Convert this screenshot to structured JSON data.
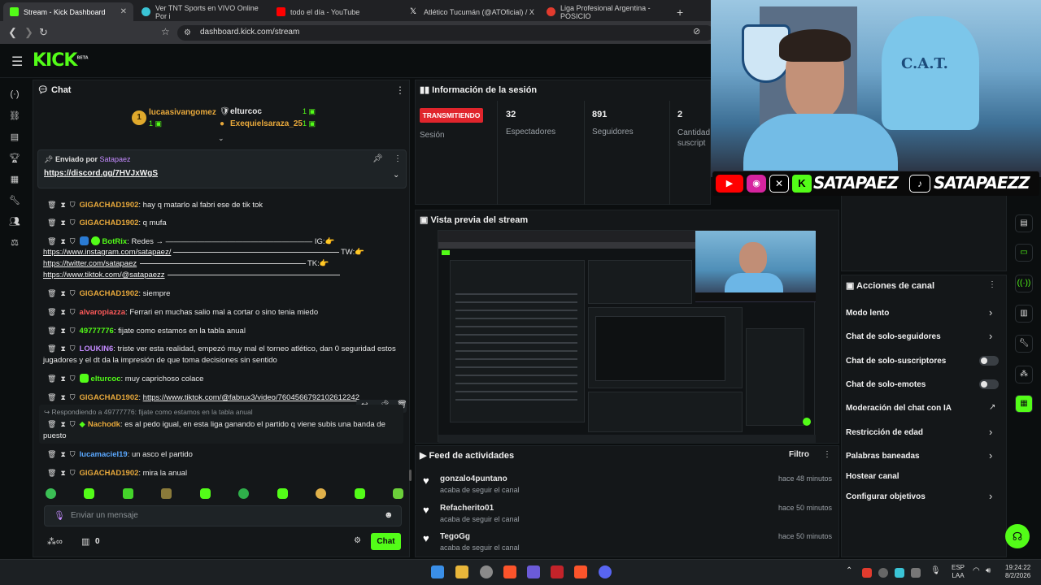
{
  "browser": {
    "tabs": [
      {
        "title": "Stream - Kick Dashboard",
        "color": "#53fc18"
      },
      {
        "title": "Ver TNT Sports en VIVO Online Por i",
        "color": "#3ac4d6"
      },
      {
        "title": "todo el día - YouTube",
        "color": "#ff0000"
      },
      {
        "title": "Atlético Tucumán (@ATOficial) / X",
        "color": "#ffffff"
      },
      {
        "title": "Liga Profesional Argentina - POSICIO",
        "color": "#e23b2e"
      }
    ],
    "url": "dashboard.kick.com/stream"
  },
  "kick": {
    "logo": "KICK",
    "logo_sup": "BETA",
    "accent": "#53fc18"
  },
  "chat": {
    "title": "Chat",
    "top_gifters": [
      {
        "rank": "1",
        "name": "lucaasivangomez",
        "count": "1"
      },
      {
        "name": "elturcoc",
        "count": "1"
      },
      {
        "name": "Exequielsaraza_25",
        "count": "1"
      }
    ],
    "pinned": {
      "label": "Enviado por",
      "author": "Satapaez",
      "link": "https://discord.gg/7HVJxWgS"
    },
    "messages": [
      {
        "user": "GIGACHAD1902",
        "color": "#e7a83b",
        "text": "hay q matarlo al fabri ese de tik tok"
      },
      {
        "user": "GIGACHAD1902",
        "color": "#e7a83b",
        "text": "q mufa"
      },
      {
        "user": "BotRix",
        "color": "#53fc18",
        "text": "Redes →  ——————————————————— IG:👉"
      },
      {
        "user": "GIGACHAD1902",
        "color": "#e7a83b",
        "text": "siempre"
      },
      {
        "user": "alvaropiazza",
        "color": "#ff5a5a",
        "text": "Ferrari en muchas salio mal a cortar o sino tenia miedo"
      },
      {
        "user": "49777776",
        "color": "#53fc18",
        "text": "fijate como estamos en la tabla anual"
      },
      {
        "user": "LOUKIN6",
        "color": "#c48bff",
        "text": "triste ver esta realidad, empezó muy mal el torneo atlético, dan 0 seguridad estos jugadores y el dt da la impresión de que toma decisiones sin sentido"
      },
      {
        "user": "elturcoc",
        "color": "#53fc18",
        "text": "muy caprichoso colace"
      },
      {
        "user": "GIGACHAD1902",
        "color": "#e7a83b",
        "text": "https://www.tiktok.com/@fabrux3/video/7604566792102612242"
      },
      {
        "user": "Nachodk",
        "color": "#e7a83b",
        "text": "es al pedo igual, en esta liga ganando el partido q viene subis una banda de puesto"
      },
      {
        "user": "lucamaciel19",
        "color": "#5aa8ff",
        "text": "un asco el partido"
      },
      {
        "user": "GIGACHAD1902",
        "color": "#e7a83b",
        "text": "mira la anual"
      }
    ],
    "botrix_links": [
      "https://www.instagram.com/satapaez/",
      "https://twitter.com/satapaez",
      "https://www.tiktok.com/@satapaezz"
    ],
    "botrix_tags": [
      "TW:👉",
      "TK:👉"
    ],
    "reply_note": "Respondiendo a 49777776: fijate como estamos en la tabla anual",
    "input_placeholder": "Enviar un mensaje",
    "points": "0",
    "send_label": "Chat"
  },
  "session": {
    "title": "Información de la sesión",
    "live_label": "TRANSMITIENDO",
    "session_label": "Sesión",
    "stats": [
      {
        "value": "32",
        "label": "Espectadores"
      },
      {
        "value": "891",
        "label": "Seguidores"
      },
      {
        "value": "2",
        "label": "Cantidad suscript"
      }
    ]
  },
  "preview": {
    "title": "Vista previa del stream"
  },
  "feed": {
    "title": "Feed de actividades",
    "filter_label": "Filtro",
    "items": [
      {
        "name": "gonzalo4puntano",
        "action": "acaba de seguir el canal",
        "time": "hace 48 minutos"
      },
      {
        "name": "Refacherito01",
        "action": "acaba de seguir el canal",
        "time": "hace 50 minutos"
      },
      {
        "name": "TegoGg",
        "action": "acaba de seguir el canal",
        "time": "hace 50 minutos"
      }
    ]
  },
  "actions": {
    "title": "Acciones de canal",
    "items": [
      "Modo lento",
      "Chat de solo-seguidores",
      "Chat de solo-suscriptores",
      "Chat de solo-emotes",
      "Moderación del chat con IA",
      "Restricción de edad",
      "Palabras baneadas",
      "Hostear canal",
      "Configurar objetivos"
    ]
  },
  "webcam": {
    "overlay_handle_1": "SATAPAEZ",
    "overlay_handle_2": "SATAPAEZZ",
    "jersey_text": "C.A.T."
  },
  "taskbar": {
    "lang_1": "ESP",
    "lang_2": "LAA",
    "time": "19:24:22",
    "date": "8/2/2026"
  }
}
